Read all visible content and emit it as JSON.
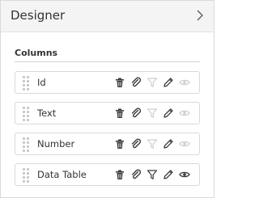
{
  "header": {
    "title": "Designer",
    "chevron_icon": "chevron-right-icon"
  },
  "section": {
    "title": "Columns"
  },
  "columns": [
    {
      "label": "Id",
      "filter_active": false,
      "visibility_active": false
    },
    {
      "label": "Text",
      "filter_active": false,
      "visibility_active": false
    },
    {
      "label": "Number",
      "filter_active": false,
      "visibility_active": false
    },
    {
      "label": "Data Table",
      "filter_active": true,
      "visibility_active": true
    }
  ],
  "icons": [
    "drag-handle-icon",
    "trash-icon",
    "paperclip-icon",
    "filter-icon",
    "pencil-icon",
    "eye-icon"
  ],
  "colors": {
    "icon_active": "#3a3a3a",
    "icon_inactive": "#cfcfcf",
    "header_bg": "#f4f4f4",
    "border": "#d9d9d9"
  }
}
